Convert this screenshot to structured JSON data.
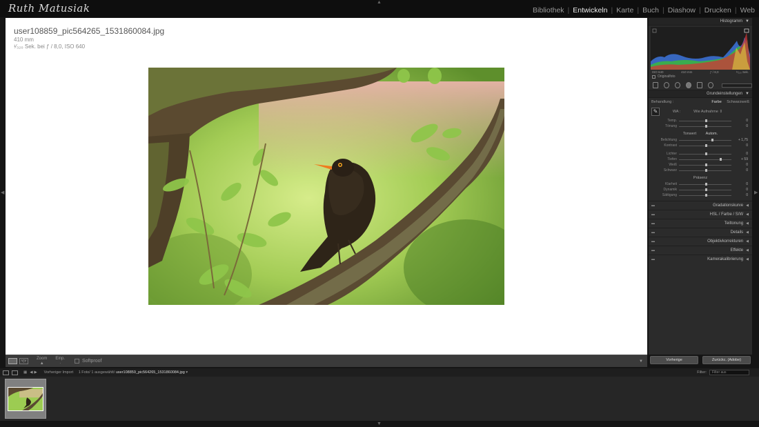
{
  "app": {
    "logo_text": "Ruth Matusiak"
  },
  "modules": [
    {
      "label": "Bibliothek",
      "active": false
    },
    {
      "label": "Entwickeln",
      "active": true
    },
    {
      "label": "Karte",
      "active": false
    },
    {
      "label": "Buch",
      "active": false
    },
    {
      "label": "Diashow",
      "active": false
    },
    {
      "label": "Drucken",
      "active": false
    },
    {
      "label": "Web",
      "active": false
    }
  ],
  "image_info": {
    "filename": "user108859_pic564265_1531860084.jpg",
    "focal_length": "410 mm",
    "exposure": "¹⁄₃₂₀ Sek. bei ƒ / 8,0, ISO 640"
  },
  "toolbar": {
    "zoom_label": "Zoom",
    "einp_label": "Einp.",
    "softproof_label": "Softproof"
  },
  "histogram": {
    "title": "Histogramm",
    "iso": "ISO 640",
    "focal": "410 mm",
    "aperture": "ƒ / 8,0",
    "shutter": "¹⁄₃₂₀ Sek.",
    "original_label": "Originalfoto"
  },
  "basic": {
    "title": "Grundeinstellungen",
    "treatment_label": "Behandlung :",
    "color_label": "Farbe",
    "bw_label": "Schwarzweiß",
    "wb_label": "WA :",
    "wb_value": "Wie Aufnahme",
    "tone_label": "Tonwert",
    "auto_label": "Autom.",
    "presence_label": "Präsenz",
    "wb_sliders": [
      {
        "label": "Temp.",
        "value": "0",
        "pos": 0.5
      },
      {
        "label": "Tönung",
        "value": "0",
        "pos": 0.5
      }
    ],
    "tone_sliders": [
      {
        "label": "Belichtung",
        "value": "+ 1,75",
        "pos": 0.62
      },
      {
        "label": "Kontrast",
        "value": "0",
        "pos": 0.5
      }
    ],
    "tone_sliders2": [
      {
        "label": "Lichter",
        "value": "0",
        "pos": 0.5
      },
      {
        "label": "Tiefen",
        "value": "+ 59",
        "pos": 0.78
      },
      {
        "label": "Weiß",
        "value": "0",
        "pos": 0.5
      },
      {
        "label": "Schwarz",
        "value": "0",
        "pos": 0.5
      }
    ],
    "presence_sliders": [
      {
        "label": "Klarheit",
        "value": "0",
        "pos": 0.5
      },
      {
        "label": "Dynamik",
        "value": "0",
        "pos": 0.5
      },
      {
        "label": "Sättigung",
        "value": "0",
        "pos": 0.5
      }
    ]
  },
  "sections": [
    "Gradationskurve",
    "HSL / Farbe / S/W",
    "Teiltonung",
    "Details",
    "Objektivkorrekturen",
    "Effekte",
    "Kamerakalibrierung"
  ],
  "right_buttons": {
    "previous": "Vorherige",
    "reset": "Zurückс. (Adobe)"
  },
  "filmstrip": {
    "source": "Vorheriger Import",
    "count": "1 Foto/ 1 ausgewählt/",
    "selected_file": "user108859_pic564265_1531860084.jpg",
    "filter_label": "Filter:",
    "filter_value": "Filter aus"
  },
  "colors": {
    "accent_active": "#eaeaea",
    "panel_bg": "#2b2b2b",
    "canvas_bg": "#ffffff"
  }
}
